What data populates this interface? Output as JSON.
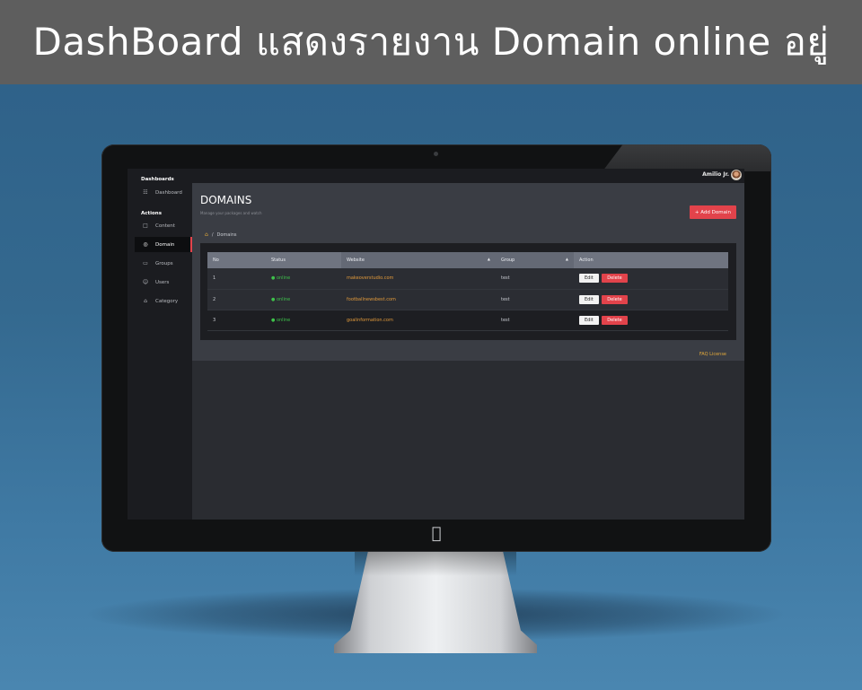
{
  "banner": {
    "title": "DashBoard แสดงรายงาน Domain online อยู่"
  },
  "topbar": {
    "user_name": "Amilio Jr."
  },
  "sidebar": {
    "headings": {
      "dashboards": "Dashboards",
      "actions": "Actions"
    },
    "items": [
      {
        "label": "Dashboard",
        "icon": "grid-icon"
      },
      {
        "label": "Content",
        "icon": "file-icon"
      },
      {
        "label": "Domain",
        "icon": "globe-icon",
        "active": true
      },
      {
        "label": "Groups",
        "icon": "folder-icon"
      },
      {
        "label": "Users",
        "icon": "users-icon"
      },
      {
        "label": "Category",
        "icon": "home-icon"
      }
    ]
  },
  "page": {
    "title": "DOMAINS",
    "subtitle": "Manage your packages and watch",
    "add_button": "+ Add Domain",
    "breadcrumb": {
      "separator": "/",
      "current": "Domains"
    }
  },
  "table": {
    "columns": [
      "No",
      "Status",
      "Website",
      "Group",
      "Action"
    ],
    "rows": [
      {
        "no": "1",
        "status": "online",
        "website": "makeoverstudio.com",
        "group": "test"
      },
      {
        "no": "2",
        "status": "online",
        "website": "footballnewsbest.com",
        "group": "test"
      },
      {
        "no": "3",
        "status": "online",
        "website": "goalinformation.com",
        "group": "test"
      }
    ],
    "edit_label": "Edit",
    "delete_label": "Delete"
  },
  "footer": {
    "links": "FAQ  License"
  },
  "colors": {
    "accent": "#e2434b",
    "online": "#3ec24b",
    "link": "#e29a3b"
  }
}
